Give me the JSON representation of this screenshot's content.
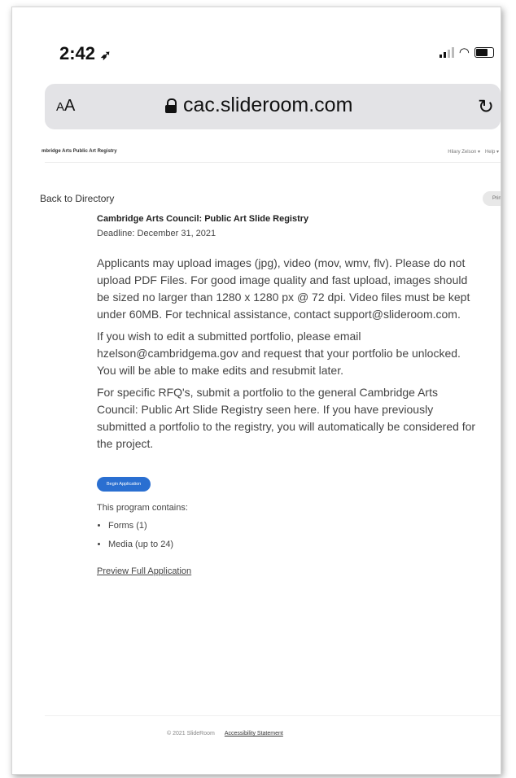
{
  "status": {
    "time": "2:42",
    "location_icon": "location-arrow-icon"
  },
  "browser": {
    "text_size_label": "AA",
    "url": "cac.slideroom.com",
    "reload_icon": "reload-icon"
  },
  "site": {
    "title": "mbridge Arts Public Art Registry",
    "user_menu": "Hilary Zelson ▾",
    "help_menu": "Help ▾",
    "back_link": "Back to Directory",
    "print_label": "Print"
  },
  "program": {
    "title": "Cambridge Arts Council: Public Art Slide Registry",
    "deadline": "Deadline: December 31, 2021",
    "paragraphs": [
      "Applicants may upload images (jpg), video (mov, wmv, flv). Please do not upload PDF Files. For good image quality and fast upload, images should be sized no larger than 1280 x 1280 px @ 72 dpi. Video files must be kept under 60MB. For technical assistance, contact support@slideroom.com.",
      "If you wish to edit a submitted portfolio, please email hzelson@cambridgema.gov and request that your portfolio be unlocked. You will be able to make edits and resubmit later.",
      "For specific RFQ's, submit a portfolio to the general Cambridge Arts Council: Public Art Slide Registry seen here. If you have previously submitted a portfolio to the registry, you will automatically be considered for the project."
    ],
    "begin_label": "Begin Application",
    "contains_label": "This program contains:",
    "contents": [
      "Forms (1)",
      "Media (up to 24)"
    ],
    "preview_label": "Preview Full Application"
  },
  "footer": {
    "copyright": "© 2021 SlideRoom",
    "accessibility": "Accessibility Statement"
  }
}
